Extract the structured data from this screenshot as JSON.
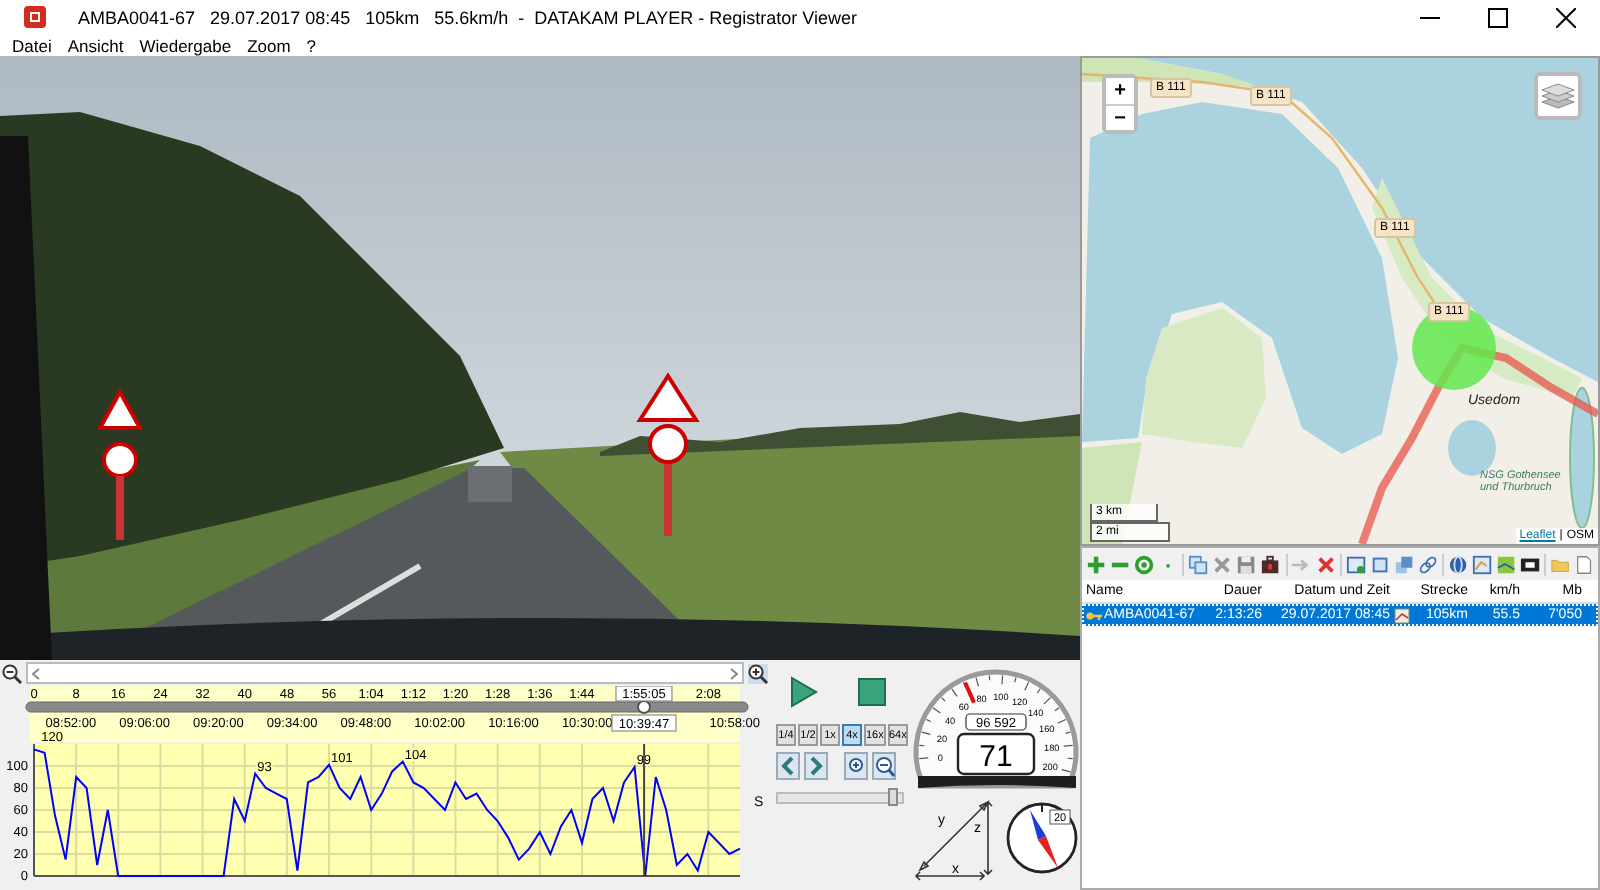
{
  "title_bar": {
    "title": "AMBA0041-67   29.07.2017 08:45   105km   55.6km/h  -  DATAKAM PLAYER - Registrator Viewer"
  },
  "menu": [
    {
      "label": "Datei"
    },
    {
      "label": "Ansicht"
    },
    {
      "label": "Wiedergabe"
    },
    {
      "label": "Zoom"
    },
    {
      "label": "?"
    }
  ],
  "timeline": {
    "position": "1:55:05",
    "clock_time": "10:39:47",
    "level": 0.864,
    "clock_ticks": [
      "08:52:00",
      "09:06:00",
      "09:20:00",
      "09:34:00",
      "09:48:00",
      "10:02:00",
      "10:16:00",
      "10:30:00",
      "10:58:00"
    ],
    "side_label": "S",
    "chart_data": {
      "type": "line",
      "x": [
        0,
        2,
        4,
        6,
        8,
        10,
        12,
        14,
        16,
        18,
        20,
        22,
        24,
        26,
        28,
        30,
        32,
        34,
        36,
        38,
        40,
        42,
        44,
        46,
        48,
        50,
        52,
        54,
        56,
        58,
        60,
        62,
        64,
        66,
        68,
        70,
        72,
        74,
        76,
        78,
        80,
        82,
        84,
        86,
        88,
        90,
        92,
        94,
        96,
        98,
        100,
        102,
        104,
        106,
        108,
        110,
        112,
        114,
        116,
        118,
        120,
        122,
        124,
        126,
        128,
        130,
        132,
        134
      ],
      "series": [
        {
          "color": "#0000ff",
          "values": [
            115,
            112,
            55,
            15,
            90,
            80,
            10,
            60,
            0,
            0,
            0,
            0,
            0,
            0,
            0,
            0,
            0,
            0,
            0,
            70,
            50,
            93,
            80,
            75,
            70,
            5,
            85,
            90,
            101,
            80,
            70,
            90,
            60,
            75,
            95,
            104,
            85,
            80,
            70,
            60,
            85,
            70,
            75,
            60,
            50,
            35,
            15,
            25,
            40,
            20,
            45,
            60,
            30,
            70,
            80,
            50,
            85,
            99,
            0,
            90,
            60,
            10,
            20,
            5,
            40,
            30,
            20,
            25
          ]
        }
      ],
      "xlim": [
        0,
        134
      ],
      "ylim": [
        0,
        120
      ],
      "grid": true,
      "ref_lines": [
        {
          "axis": "x",
          "value": 115.8
        }
      ],
      "xticks": [
        0,
        8,
        16,
        24,
        32,
        40,
        48,
        56,
        {
          "value": 64,
          "label": "1:04"
        },
        {
          "value": 72,
          "label": "1:12"
        },
        {
          "value": 80,
          "label": "1:20"
        },
        {
          "value": 88,
          "label": "1:28"
        },
        {
          "value": 96,
          "label": "1:36"
        },
        {
          "value": 104,
          "label": "1:44"
        },
        {
          "value": 128,
          "label": "2:08"
        }
      ],
      "yticks": [
        0,
        20,
        40,
        60,
        80,
        100
      ],
      "annotations": [
        {
          "x": 1,
          "y": 120,
          "text": "120"
        },
        {
          "x": 42,
          "y": 93,
          "text": "93"
        },
        {
          "x": 56,
          "y": 101,
          "text": "101"
        },
        {
          "x": 70,
          "y": 104,
          "text": "104"
        },
        {
          "x": 114,
          "y": 99,
          "text": "99"
        }
      ]
    }
  },
  "playback": {
    "speeds": [
      {
        "label": "1/4",
        "selected": false
      },
      {
        "label": "1/2",
        "selected": false
      },
      {
        "label": "1x",
        "selected": false
      },
      {
        "label": "4x",
        "selected": true
      },
      {
        "label": "16x",
        "selected": false
      },
      {
        "label": "64x",
        "selected": false
      }
    ],
    "volume": {
      "level": 0.97
    }
  },
  "speedometer": {
    "scale": [
      "0",
      "20",
      "40",
      "60",
      "80",
      "100",
      "120",
      "140",
      "160",
      "180",
      "200"
    ],
    "odometer": "96 592",
    "speed": "71",
    "level": 0.355
  },
  "axes": {
    "labels": [
      "x",
      "y",
      "z"
    ]
  },
  "compass": {
    "reading": "20"
  },
  "map": {
    "zoom_in": "+",
    "zoom_out": "−",
    "road_labels": [
      "B 111",
      "B 111",
      "B 111",
      "B 111"
    ],
    "town": "Usedom",
    "reserve": "NSG Gothensee und Thurbruch",
    "scale": [
      "3 km",
      "2 mi"
    ],
    "attribution": {
      "link": "Leaflet",
      "separator": "|",
      "source": "OSM"
    }
  },
  "file_list": {
    "columns": [
      "Name",
      "Dauer",
      "Datum und Zeit",
      "Strecke",
      "km/h",
      "Mb"
    ],
    "rows": [
      {
        "cells": [
          "AMBA0041-67",
          "2:13:26",
          "29.07.2017 08:45",
          "105km",
          "55.5",
          "7'050"
        ],
        "selected": true
      }
    ]
  }
}
